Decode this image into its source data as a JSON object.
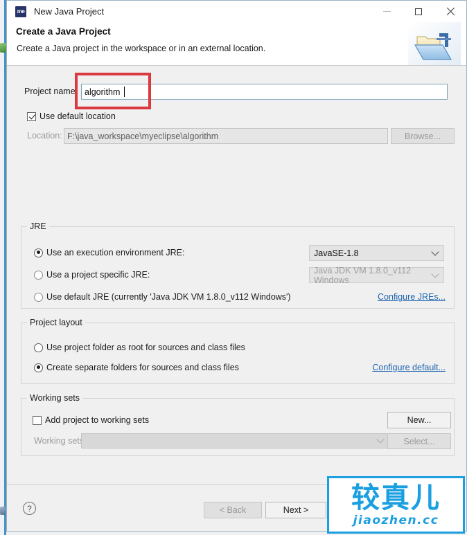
{
  "window": {
    "title": "New Java Project",
    "app_icon_text": "me",
    "controls": {
      "minimize": "minimize-icon",
      "maximize": "maximize-icon",
      "close": "close-icon"
    }
  },
  "header": {
    "title": "Create a Java Project",
    "description": "Create a Java project in the workspace or in an external location.",
    "icon": "java-project-folder-icon"
  },
  "form": {
    "project_name_label": "Project name:",
    "project_name_value": "algorithm",
    "use_default_location_label": "Use default location",
    "use_default_location_checked": true,
    "location_label": "Location:",
    "location_value": "F:\\java_workspace\\myeclipse\\algorithm",
    "location_enabled": false,
    "browse_label": "Browse...",
    "browse_enabled": false,
    "highlight_color": "#d9393f"
  },
  "jre": {
    "group_title": "JRE",
    "options": [
      {
        "label": "Use an execution environment JRE:",
        "selected": true
      },
      {
        "label": "Use a project specific JRE:",
        "selected": false
      },
      {
        "label": "Use default JRE (currently 'Java JDK VM 1.8.0_v112 Windows')",
        "selected": false
      }
    ],
    "execution_env_value": "JavaSE-1.8",
    "project_specific_value": "Java JDK VM 1.8.0_v112 Windows",
    "project_specific_enabled": false,
    "configure_link": "Configure JREs..."
  },
  "project_layout": {
    "group_title": "Project layout",
    "options": [
      {
        "label": "Use project folder as root for sources and class files",
        "selected": false
      },
      {
        "label": "Create separate folders for sources and class files",
        "selected": true
      }
    ],
    "configure_link": "Configure default..."
  },
  "working_sets": {
    "group_title": "Working sets",
    "add_label": "Add project to working sets",
    "add_checked": false,
    "sets_label": "Working sets:",
    "sets_value": "",
    "sets_enabled": false,
    "new_label": "New...",
    "select_label": "Select...",
    "select_enabled": false
  },
  "footer": {
    "help_label": "?",
    "back_label": "< Back",
    "back_enabled": false,
    "next_label": "Next >",
    "next_enabled": true
  },
  "watermark": {
    "cn_text": "较真儿",
    "en_text": "jiaozhen.cc",
    "color": "#1a9fe0"
  }
}
